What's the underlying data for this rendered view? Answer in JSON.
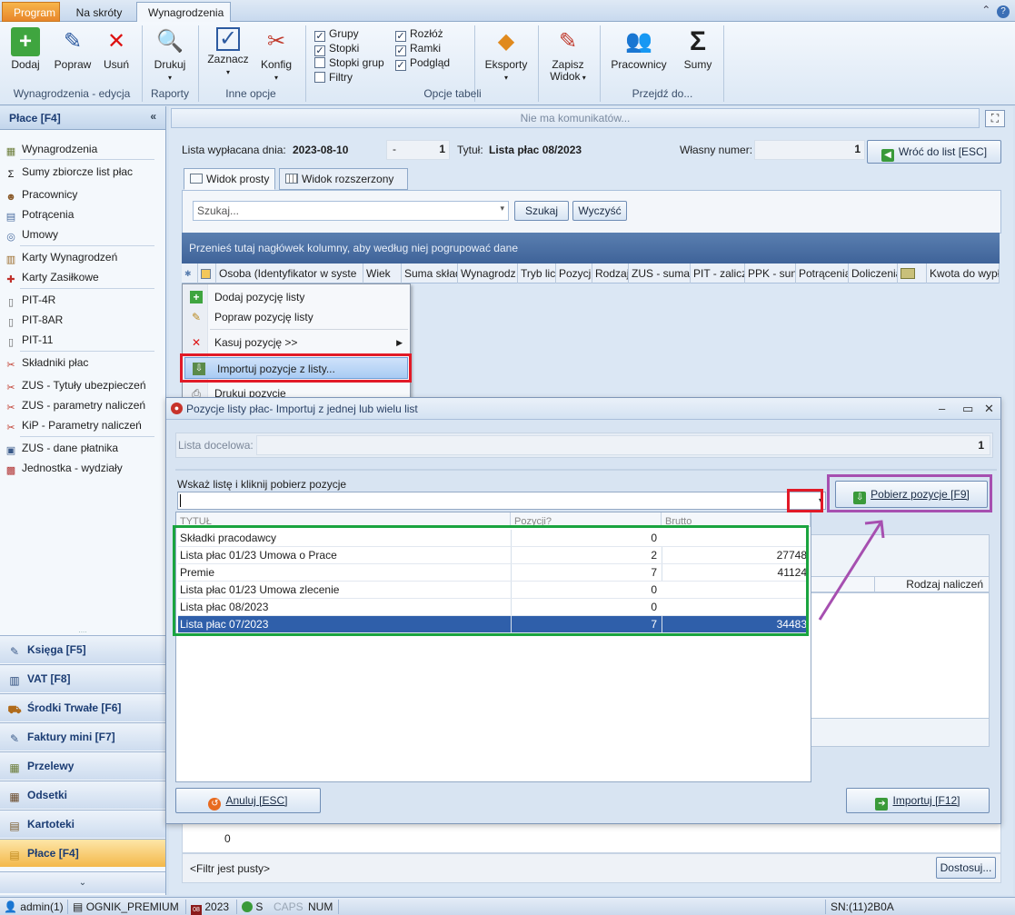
{
  "ribbon_tabs": {
    "program": "Program",
    "skroty": "Na skróty",
    "wynagrodzenia": "Wynagrodzenia"
  },
  "ribbon": {
    "dodaj": "Dodaj",
    "popraw": "Popraw",
    "usun": "Usuń",
    "grp_edycja": "Wynagrodzenia - edycja",
    "drukuj": "Drukuj",
    "grp_raporty": "Raporty",
    "zaznacz": "Zaznacz",
    "konfig": "Konfig",
    "grp_inne": "Inne opcje",
    "chk_grupy": "Grupy",
    "chk_stopki": "Stopki",
    "chk_stopki_grup": "Stopki grup",
    "chk_filtry": "Filtry",
    "chk_rozloz": "Rozłóż",
    "chk_ramki": "Ramki",
    "chk_podglad": "Podgląd",
    "eksporty": "Eksporty",
    "zapisz": "Zapisz",
    "widok": "Widok",
    "grp_tabeli": "Opcje tabeli",
    "pracownicy": "Pracownicy",
    "sumy": "Sumy",
    "grp_przejdz": "Przejdź do..."
  },
  "sidebar": {
    "title": "Płace [F4]",
    "items": [
      {
        "label": "Wynagrodzenia",
        "icon": "payroll-icon"
      },
      {
        "label": "Sumy zbiorcze list płac",
        "icon": "sigma-icon"
      },
      {
        "label": "Pracownicy",
        "icon": "people-icon"
      },
      {
        "label": "Potrącenia",
        "icon": "deduction-icon"
      },
      {
        "label": "Umowy",
        "icon": "contract-icon"
      },
      {
        "label": "Karty Wynagrodzeń",
        "icon": "card-icon"
      },
      {
        "label": "Karty Zasiłkowe",
        "icon": "medical-icon"
      },
      {
        "label": "PIT-4R",
        "icon": "document-icon"
      },
      {
        "label": "PIT-8AR",
        "icon": "document-icon"
      },
      {
        "label": "PIT-11",
        "icon": "document-icon"
      },
      {
        "label": "Składniki płac",
        "icon": "tools-icon"
      },
      {
        "label": "ZUS - Tytuły ubezpieczeń",
        "icon": "tools-icon"
      },
      {
        "label": "ZUS - parametry naliczeń",
        "icon": "tools-icon"
      },
      {
        "label": "KiP - Parametry naliczeń",
        "icon": "tools-icon"
      },
      {
        "label": "ZUS - dane płatnika",
        "icon": "id-card-icon"
      },
      {
        "label": "Jednostka - wydziały",
        "icon": "building-icon"
      }
    ],
    "nav": [
      {
        "label": "Księga [F5]"
      },
      {
        "label": "VAT [F8]"
      },
      {
        "label": "Środki Trwałe [F6]"
      },
      {
        "label": "Faktury mini [F7]"
      },
      {
        "label": "Przelewy"
      },
      {
        "label": "Odsetki"
      },
      {
        "label": "Kartoteki"
      },
      {
        "label": "Płace [F4]"
      }
    ]
  },
  "messages": "Nie ma komunikatów...",
  "header": {
    "lista_label": "Lista wypłacana dnia:",
    "lista_date": "2023-08-10",
    "dash": "-",
    "lista_num": "1",
    "tytul_label": "Tytuł:",
    "tytul": "Lista płac 08/2023",
    "wlasny_label": "Własny numer:",
    "wlasny": "1",
    "wroc": "Wróć do list [ESC]"
  },
  "view_tabs": {
    "prosty": "Widok prosty",
    "rozszerzony": "Widok rozszerzony"
  },
  "search": {
    "placeholder": "Szukaj...",
    "szukaj": "Szukaj",
    "wyczysc": "Wyczyść"
  },
  "group_panel": "Przenieś tutaj nagłówek kolumny, aby według niej pogrupować dane",
  "grid_columns": [
    "Osoba (Identyfikator w syste",
    "Wiek",
    "Suma skład",
    "Wynagrodz",
    "Tryb lic",
    "Pozycj",
    "Rodzaj",
    "ZUS - suma",
    "PIT - zalicz",
    "PPK - sun",
    "Potrącenia",
    "Doliczenia",
    "",
    "Kwota do wypł"
  ],
  "context_menu": {
    "dodaj": "Dodaj pozycję listy",
    "popraw": "Popraw pozycję listy",
    "kasuj": "Kasuj pozycję >>",
    "importuj": "Importuj pozycje z listy...",
    "drukuj": "Drukuj pozycje"
  },
  "dialog": {
    "title": "Pozycje listy płac- Importuj z jednej lub wielu list",
    "lista_docelowa": "Lista docelowa:",
    "lista_docelowa_val": "1",
    "wskaz": "Wskaż listę i kliknij pobierz pozycje",
    "pobierz": "Pobierz pozycje [F9]",
    "col_tytul": "TYTUŁ",
    "col_pozycji": "Pozycji?",
    "col_brutto": "Brutto",
    "rows": [
      {
        "tytul": "Składki pracodawcy",
        "pozycji": "0",
        "brutto": ""
      },
      {
        "tytul": "Lista płac 01/23 Umowa o Prace",
        "pozycji": "2",
        "brutto": "27748"
      },
      {
        "tytul": "Premie",
        "pozycji": "7",
        "brutto": "41124"
      },
      {
        "tytul": "Lista płac 01/23 Umowa zlecenie",
        "pozycji": "0",
        "brutto": ""
      },
      {
        "tytul": "Lista płac 08/2023",
        "pozycji": "0",
        "brutto": ""
      },
      {
        "tytul": "Lista płac 07/2023",
        "pozycji": "7",
        "brutto": "34483"
      }
    ],
    "rodzaj_naliczen": "Rodzaj naliczeń",
    "anuluj": "Anuluj [ESC]",
    "importuj": "Importuj [F12]"
  },
  "footer": {
    "zero": "0",
    "filtr": "<Filtr jest pusty>",
    "dostosuj": "Dostosuj..."
  },
  "status": {
    "user": "admin(1)",
    "db": "OGNIK_PREMIUM",
    "year": "2023",
    "s": "S",
    "caps": "CAPS",
    "num": "NUM",
    "sn": "SN:(11)2B0A"
  }
}
